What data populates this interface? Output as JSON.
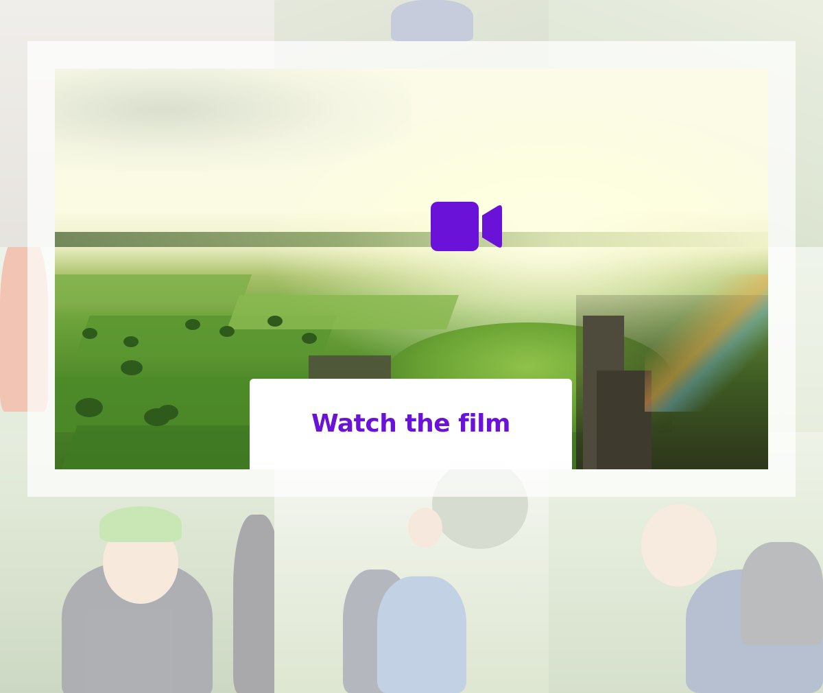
{
  "cta": {
    "label": "Watch the film"
  },
  "icons": {
    "video": "video-camera-icon"
  },
  "colors": {
    "accent": "#6a12d8",
    "overlay": "#ffffff"
  }
}
